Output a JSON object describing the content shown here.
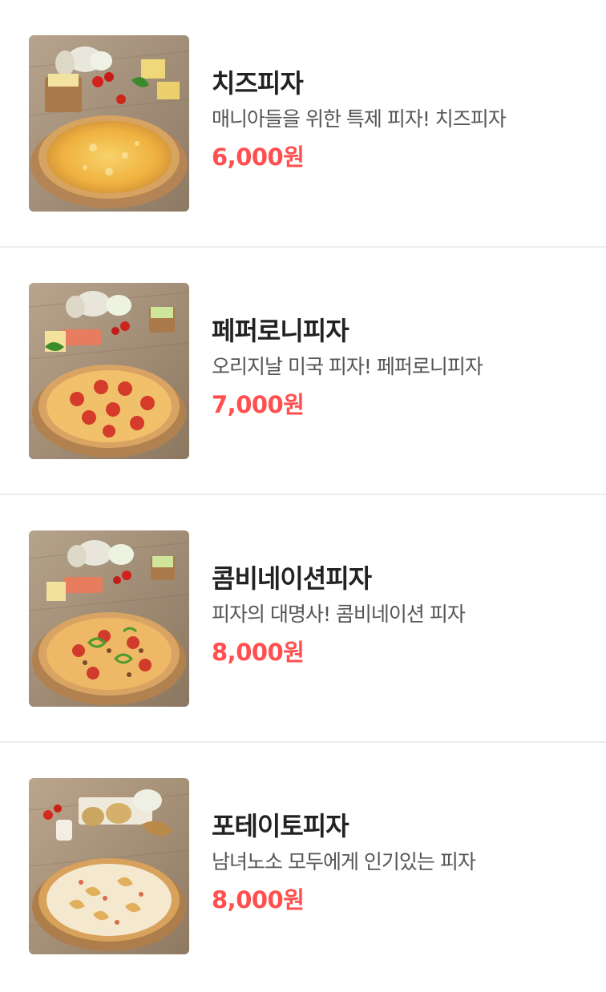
{
  "menu": {
    "items": [
      {
        "name": "치즈피자",
        "description": "매니아들을 위한 특제 피자! 치즈피자",
        "price": "6,000원",
        "image": "cheese-pizza-photo"
      },
      {
        "name": "페퍼로니피자",
        "description": "오리지날 미국 피자! 페퍼로니피자",
        "price": "7,000원",
        "image": "pepperoni-pizza-photo"
      },
      {
        "name": "콤비네이션피자",
        "description": "피자의 대명사! 콤비네이션 피자",
        "price": "8,000원",
        "image": "combination-pizza-photo"
      },
      {
        "name": "포테이토피자",
        "description": "남녀노소 모두에게 인기있는 피자",
        "price": "8,000원",
        "image": "potato-pizza-photo"
      }
    ]
  },
  "colors": {
    "price": "#ff4f4f",
    "name": "#222222",
    "description": "#555555",
    "divider": "#ececec"
  }
}
